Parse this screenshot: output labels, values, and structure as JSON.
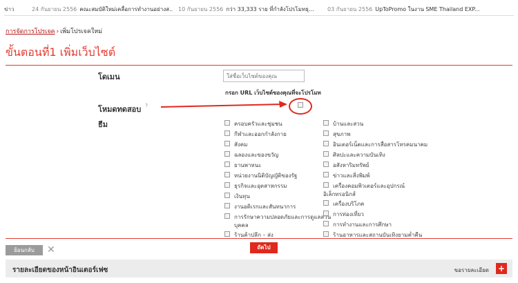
{
  "news": {
    "label": "ข่าว",
    "items": [
      {
        "date": "24 กันยายน 2556",
        "text": "คณะสมบัติใหม่เคลื่อการทำงานอย่างส..."
      },
      {
        "date": "10 กันยายน 2556",
        "text": "กว่า 33,333 ราย ที่กำลังโปรโมทธุ..."
      },
      {
        "date": "03 กันยายน 2556",
        "text": "UpToPromo ในงาน SME Thailand EXP..."
      }
    ]
  },
  "breadcrumb": {
    "link": "การจัดการโปรเจค",
    "separator": "›",
    "current": "เพิ่มโปรเจคใหม่"
  },
  "title": "ขั้นตอนที่1 เพิ่มเว็บไซต์",
  "form": {
    "domain_label": "โดเมน",
    "domain_placeholder": "ใส่ชื่อเว็บไซต์ของคุณ",
    "domain_hint": "กรอก URL เว็บไซต์ของคุณที่จะโปรโมท",
    "test_label": "โหมดทดสอบ",
    "test_help": "?",
    "theme_label": "ธีม",
    "themes_left": [
      "ครอบครัวและชุมชน",
      "กีฬาและออกกำลังกาย",
      "สังคม",
      "ฉลองและของขวัญ",
      "ยานพาหนะ",
      "หน่วยงานนิติบัญญัติของรัฐ",
      "ธุรกิจและอุตสาหกรรม",
      "เงินทุน",
      "งานอดิเรกและสันทนาการ",
      "การรักษาความปลอดภัยและการดูแลส่วน",
      "ร้านค้าปลีก – ส่ง"
    ],
    "themes_left_cont": "บุคคล",
    "themes_right": [
      "บ้านและสวน",
      "สุขภาพ",
      "อินเตอร์เน็ตและการสื่อสารโทรคมนาคม",
      "ศิลปะและความบันเทิง",
      "อสังหาริมทรัพย์",
      "ข่าวและสิ่งพิมพ์",
      "เครื่องคอมพิวเตอร์และอุปกรณ์",
      "เครื่องบริโภค",
      "การท่องเที่ยว",
      "การทำงานและการศึกษา",
      "ร้านอาหารและสถานบันเทิงยามค่ำคืน"
    ],
    "themes_right_cont": "อิเล็กทรอนิกส์"
  },
  "buttons": {
    "back": "ย้อนกลับ",
    "close": "✕",
    "next": "ถัดไป"
  },
  "panel": {
    "title": "รายละเอียดของหน้าอินเตอร์เฟซ",
    "request": "ขอรายละเอียด",
    "plus": "+"
  },
  "colors": {
    "accent": "#e43a2f",
    "back_button": "#9b9b9b",
    "panel_bg": "#ececec"
  }
}
